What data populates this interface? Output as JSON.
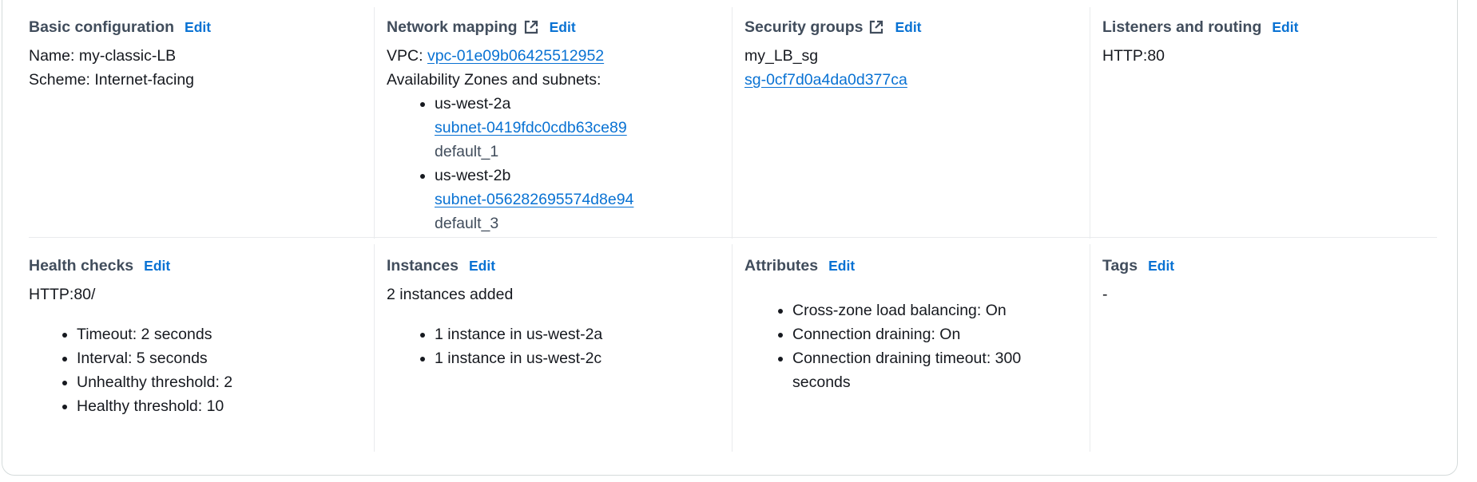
{
  "common": {
    "edit_label": "Edit"
  },
  "basic_configuration": {
    "title": "Basic configuration",
    "name_line": "Name: my-classic-LB",
    "scheme_line": "Scheme: Internet-facing"
  },
  "network_mapping": {
    "title": "Network mapping",
    "vpc_prefix": "VPC: ",
    "vpc_id": "vpc-01e09b06425512952",
    "az_label": "Availability Zones and subnets:",
    "zones": [
      {
        "zone": "us-west-2a",
        "subnet": "subnet-0419fdc0cdb63ce89",
        "subnet_name": "default_1"
      },
      {
        "zone": "us-west-2b",
        "subnet": "subnet-056282695574d8e94",
        "subnet_name": "default_3"
      }
    ]
  },
  "security_groups": {
    "title": "Security groups",
    "group_name": "my_LB_sg",
    "group_id": "sg-0cf7d0a4da0d377ca"
  },
  "listeners": {
    "title": "Listeners and routing",
    "value": "HTTP:80"
  },
  "health_checks": {
    "title": "Health checks",
    "target": "HTTP:80/",
    "items": [
      "Timeout: 2 seconds",
      "Interval: 5 seconds",
      "Unhealthy threshold: 2",
      "Healthy threshold: 10"
    ]
  },
  "instances": {
    "title": "Instances",
    "summary": "2 instances added",
    "items": [
      "1 instance in us-west-2a",
      "1 instance in us-west-2c"
    ]
  },
  "attributes": {
    "title": "Attributes",
    "items": [
      "Cross-zone load balancing: On",
      "Connection draining: On",
      "Connection draining timeout: 300 seconds"
    ]
  },
  "tags": {
    "title": "Tags",
    "value": "-"
  },
  "colors": {
    "link": "#0972d3",
    "heading": "#414d5c",
    "text": "#16191f",
    "divider": "#e9ebed"
  }
}
